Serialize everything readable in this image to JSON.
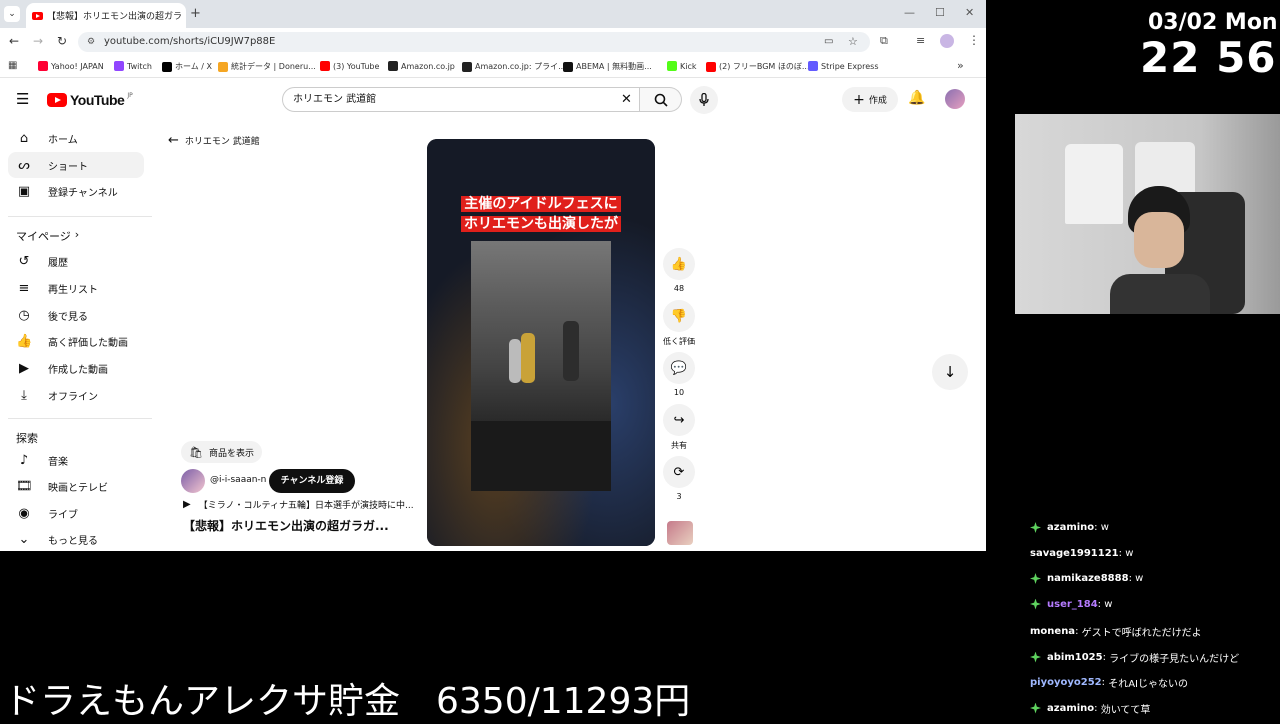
{
  "browser": {
    "tab_title": "【悲報】ホリエモン出演の超ガラ",
    "url": "youtube.com/shorts/iCU9JW7p88E",
    "bookmarks": [
      {
        "label": "Yahoo! JAPAN",
        "color": "#ff0033"
      },
      {
        "label": "Twitch",
        "color": "#9146ff"
      },
      {
        "label": "ホーム / X",
        "color": "#000000"
      },
      {
        "label": "統計データ | Doneru...",
        "color": "#f5a623"
      },
      {
        "label": "(3) YouTube",
        "color": "#ff0000"
      },
      {
        "label": "Amazon.co.jp",
        "color": "#222222"
      },
      {
        "label": "Amazon.co.jp: プライ...",
        "color": "#222222"
      },
      {
        "label": "ABEMA | 無料動画...",
        "color": "#111111"
      },
      {
        "label": "Kick",
        "color": "#53fc18"
      },
      {
        "label": "(2) フリーBGM ほのぼ...",
        "color": "#ff0000"
      },
      {
        "label": "Stripe Express",
        "color": "#635bff"
      }
    ]
  },
  "youtube": {
    "logo": "YouTube",
    "logo_region": "JP",
    "search_query": "ホリエモン 武道館",
    "create_label": "作成",
    "back_label": "ホリエモン 武道館",
    "sidebar": {
      "main": [
        {
          "label": "ホーム",
          "icon": "home-icon"
        },
        {
          "label": "ショート",
          "icon": "shorts-icon"
        },
        {
          "label": "登録チャンネル",
          "icon": "subscriptions-icon"
        }
      ],
      "my_page_heading": "マイページ",
      "my_page": [
        {
          "label": "履歴",
          "icon": "history-icon"
        },
        {
          "label": "再生リスト",
          "icon": "playlist-icon"
        },
        {
          "label": "後で見る",
          "icon": "watch-later-icon"
        },
        {
          "label": "高く評価した動画",
          "icon": "thumbs-up-icon"
        },
        {
          "label": "作成した動画",
          "icon": "my-videos-icon"
        },
        {
          "label": "オフライン",
          "icon": "download-icon"
        }
      ],
      "explore_heading": "探索",
      "explore": [
        {
          "label": "音楽",
          "icon": "music-icon"
        },
        {
          "label": "映画とテレビ",
          "icon": "film-icon"
        },
        {
          "label": "ライブ",
          "icon": "live-icon"
        },
        {
          "label": "もっと見る",
          "icon": "chevron-down-icon"
        }
      ]
    },
    "short": {
      "caption_line1": "主催のアイドルフェスに",
      "caption_line2": "ホリエモンも出演したが",
      "products_label": "商品を表示",
      "channel_handle": "@i-i-saaan-n",
      "subscribe_label": "チャンネル登録",
      "related_label": "【ミラノ・コルティナ五輪】日本選手が演技時に中...",
      "title": "【悲報】ホリエモン出演の超ガラガ...",
      "likes": "48",
      "dislike_label": "低く評価",
      "comments": "10",
      "share_label": "共有",
      "remix_count": "3"
    }
  },
  "overlay": {
    "date": "03/02 Mon",
    "time": "22 56",
    "savings_label": "ドラえもんアレクサ貯金　6350/11293円",
    "chat": [
      {
        "user": "azamino",
        "text": "w",
        "color": "#ffffff",
        "badge": true
      },
      {
        "user": "savage1991121",
        "text": "w",
        "color": "#ffffff",
        "badge": false
      },
      {
        "user": "namikaze8888",
        "text": "w",
        "color": "#ffffff",
        "badge": true
      },
      {
        "user": "user_184",
        "text": "w",
        "color": "#b57bff",
        "badge": true
      },
      {
        "user": "monena",
        "text": "ゲストで呼ばれただけだよ",
        "color": "#ffffff",
        "badge": false
      },
      {
        "user": "abim1025",
        "text": "ライブの様子見たいんだけど",
        "color": "#ffffff",
        "badge": true
      },
      {
        "user": "piyoyoyo252",
        "text": "それAIじゃないの",
        "color": "#9fb8ff",
        "badge": false
      },
      {
        "user": "azamino",
        "text": "効いてて草",
        "color": "#ffffff",
        "badge": true
      }
    ]
  }
}
